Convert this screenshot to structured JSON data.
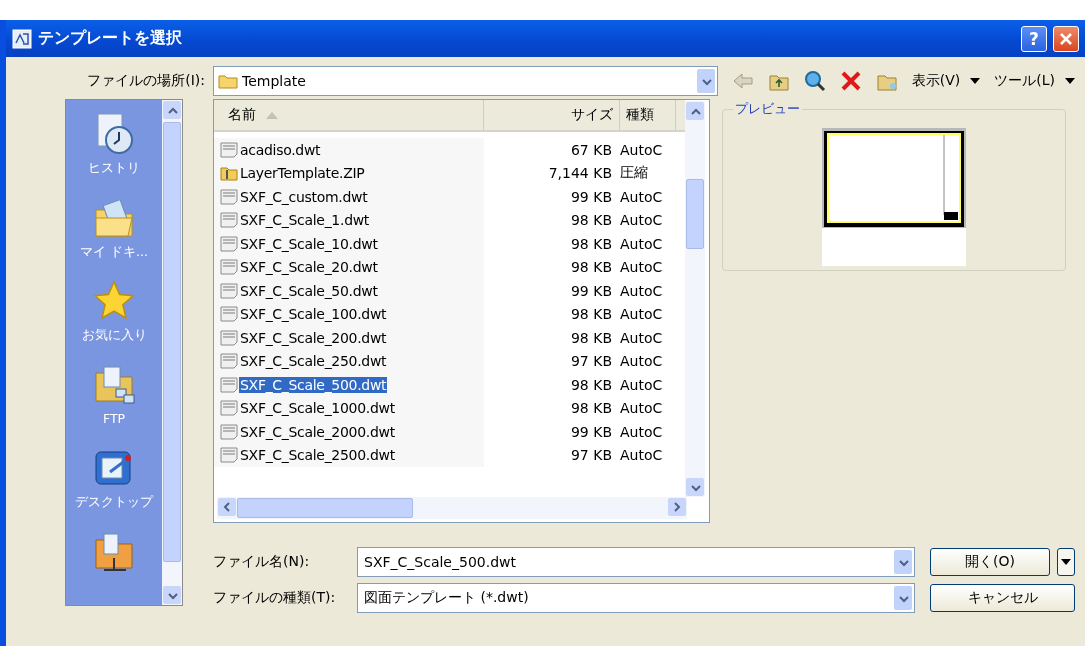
{
  "window": {
    "title": "テンプレートを選択",
    "help": "?"
  },
  "location": {
    "label": "ファイルの場所(I):",
    "value": "Template"
  },
  "menus": [
    "表示(V)",
    "ツール(L)"
  ],
  "places": [
    {
      "kind": "history",
      "label": "ヒストリ"
    },
    {
      "kind": "documents",
      "label": "マイ ドキ..."
    },
    {
      "kind": "favorites",
      "label": "お気に入り"
    },
    {
      "kind": "ftp",
      "label": "FTP"
    },
    {
      "kind": "desktop",
      "label": "デスクトップ"
    },
    {
      "kind": "network"
    }
  ],
  "columns": [
    {
      "label": "名前",
      "sorted": true
    },
    {
      "label": "サイズ",
      "sorted": false
    },
    {
      "label": "種類",
      "sorted": false
    }
  ],
  "rows": [
    {
      "kind": "dwt",
      "name": "acadiso.dwt",
      "size": "67 KB",
      "type": "AutoC",
      "selected": false
    },
    {
      "kind": "zip",
      "name": "LayerTemplate.ZIP",
      "size": "7,144 KB",
      "type": "圧縮",
      "selected": false
    },
    {
      "kind": "dwt",
      "name": "SXF_C_custom.dwt",
      "size": "99 KB",
      "type": "AutoC",
      "selected": false
    },
    {
      "kind": "dwt",
      "name": "SXF_C_Scale_1.dwt",
      "size": "98 KB",
      "type": "AutoC",
      "selected": false
    },
    {
      "kind": "dwt",
      "name": "SXF_C_Scale_10.dwt",
      "size": "98 KB",
      "type": "AutoC",
      "selected": false
    },
    {
      "kind": "dwt",
      "name": "SXF_C_Scale_20.dwt",
      "size": "98 KB",
      "type": "AutoC",
      "selected": false
    },
    {
      "kind": "dwt",
      "name": "SXF_C_Scale_50.dwt",
      "size": "99 KB",
      "type": "AutoC",
      "selected": false
    },
    {
      "kind": "dwt",
      "name": "SXF_C_Scale_100.dwt",
      "size": "98 KB",
      "type": "AutoC",
      "selected": false
    },
    {
      "kind": "dwt",
      "name": "SXF_C_Scale_200.dwt",
      "size": "98 KB",
      "type": "AutoC",
      "selected": false
    },
    {
      "kind": "dwt",
      "name": "SXF_C_Scale_250.dwt",
      "size": "97 KB",
      "type": "AutoC",
      "selected": false
    },
    {
      "kind": "dwt",
      "name": "SXF_C_Scale_500.dwt",
      "size": "98 KB",
      "type": "AutoC",
      "selected": true
    },
    {
      "kind": "dwt",
      "name": "SXF_C_Scale_1000.dwt",
      "size": "98 KB",
      "type": "AutoC",
      "selected": false
    },
    {
      "kind": "dwt",
      "name": "SXF_C_Scale_2000.dwt",
      "size": "99 KB",
      "type": "AutoC",
      "selected": false
    },
    {
      "kind": "dwt",
      "name": "SXF_C_Scale_2500.dwt",
      "size": "97 KB",
      "type": "AutoC",
      "selected": false
    }
  ],
  "preview": {
    "label": "プレビュー"
  },
  "filename": {
    "label": "ファイル名(N):",
    "value": "SXF_C_Scale_500.dwt"
  },
  "filetype": {
    "label": "ファイルの種類(T):",
    "value": "図面テンプレート (*.dwt)"
  },
  "buttons": {
    "open": "開く(O)",
    "cancel": "キャンセル"
  }
}
